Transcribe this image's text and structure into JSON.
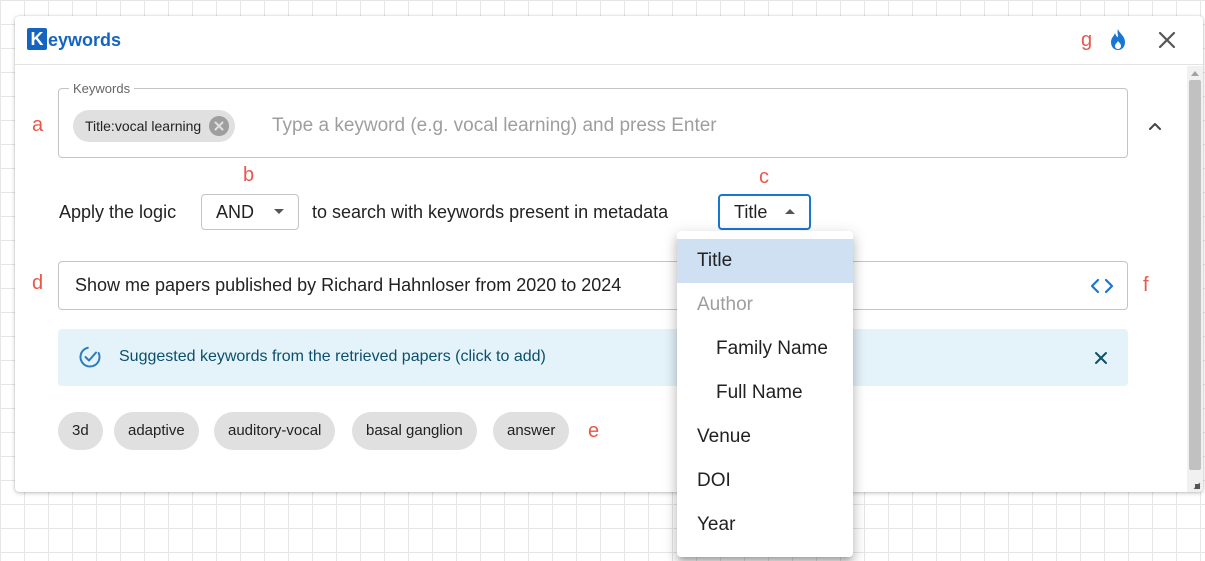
{
  "header": {
    "logo_letter": "K",
    "title": "eywords",
    "icons": [
      "flame-icon",
      "close-icon"
    ]
  },
  "markers": {
    "a": "a",
    "b": "b",
    "c": "c",
    "d": "d",
    "e": "e",
    "f": "f",
    "g": "g"
  },
  "keywords_field": {
    "legend": "Keywords",
    "chips": [
      "Title:vocal learning"
    ],
    "placeholder": "Type a keyword (e.g. vocal learning) and press Enter"
  },
  "logic_row": {
    "prefix": "Apply the logic",
    "logic_value": "AND",
    "middle": "to search with keywords present in metadata",
    "field_value": "Title"
  },
  "query": {
    "text": "Show me papers published by Richard Hahnloser from 2020 to 2024"
  },
  "alert": {
    "text": "Suggested keywords from the retrieved papers (click to add)"
  },
  "suggestions": [
    "3d",
    "adaptive",
    "auditory-vocal",
    "basal ganglion",
    "answer"
  ],
  "menu": {
    "items": [
      {
        "label": "Title",
        "kind": "option",
        "selected": true
      },
      {
        "label": "Author",
        "kind": "header"
      },
      {
        "label": "Family Name",
        "kind": "sub"
      },
      {
        "label": "Full Name",
        "kind": "sub"
      },
      {
        "label": "Venue",
        "kind": "option"
      },
      {
        "label": "DOI",
        "kind": "option"
      },
      {
        "label": "Year",
        "kind": "option"
      }
    ]
  },
  "colors": {
    "accent": "#1565c0",
    "marker": "#e8574a",
    "alert_bg": "#e4f3fa",
    "selected_bg": "#cfe0f3"
  }
}
